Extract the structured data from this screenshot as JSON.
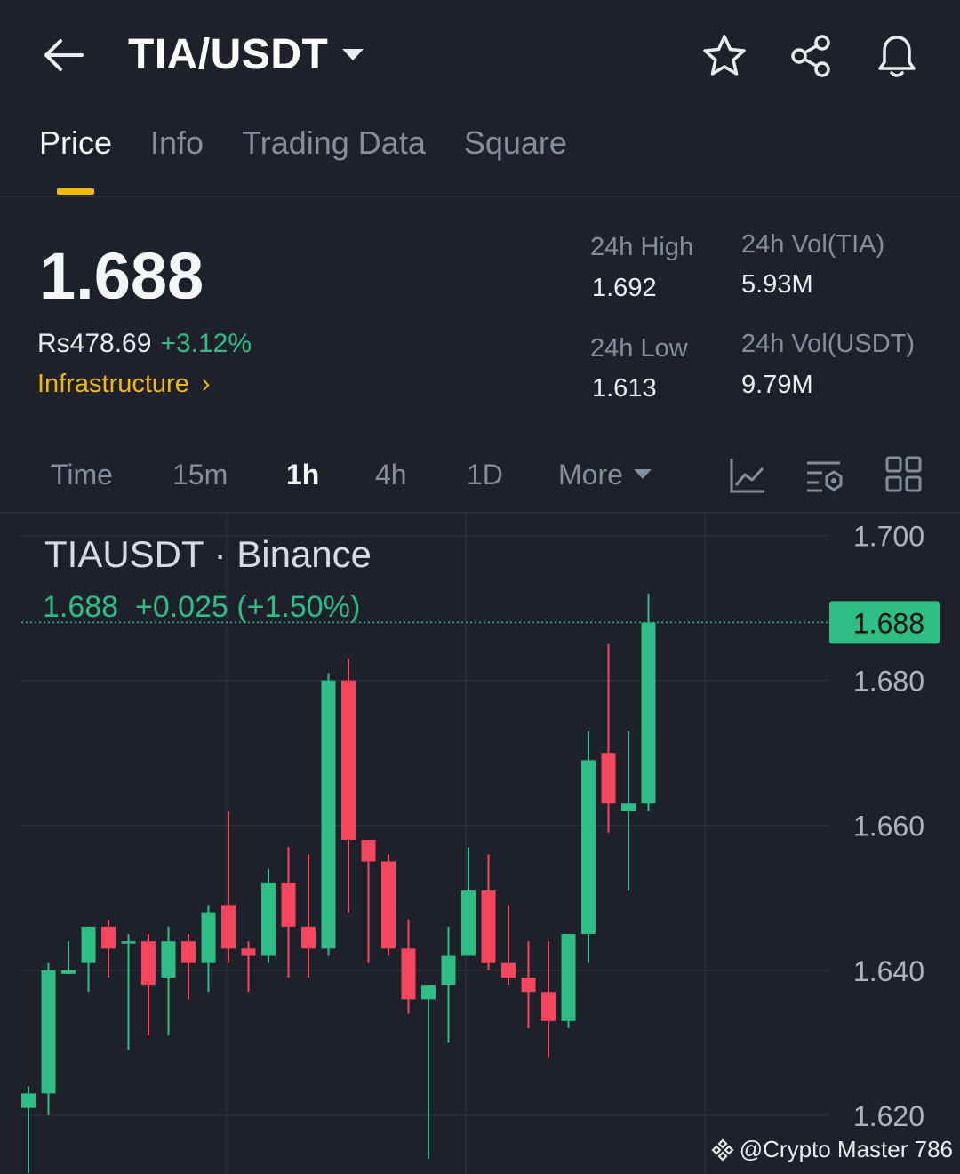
{
  "header": {
    "pair": "TIA/USDT"
  },
  "tabs": [
    "Price",
    "Info",
    "Trading Data",
    "Square"
  ],
  "price": {
    "last": "1.688",
    "fiat": "Rs478.69",
    "change": "+3.12%",
    "tag": "Infrastructure",
    "high_label": "24h High",
    "high": "1.692",
    "low_label": "24h Low",
    "low": "1.613",
    "vol_base_label": "24h Vol(TIA)",
    "vol_base": "5.93M",
    "vol_quote_label": "24h Vol(USDT)",
    "vol_quote": "9.79M"
  },
  "timeframes": [
    "Time",
    "15m",
    "1h",
    "4h",
    "1D",
    "More"
  ],
  "active_timeframe": "1h",
  "chart_header": {
    "title": "TIAUSDT · Binance",
    "summary": "1.688  +0.025 (+1.50%)"
  },
  "watermark": "@Crypto Master 786",
  "colors": {
    "up": "#2ebd85",
    "down": "#f6465d",
    "accent": "#f0b90b",
    "bg": "#1e2129"
  },
  "chart_data": {
    "type": "candlestick",
    "y_ticks": [
      "1.700",
      "1.680",
      "1.660",
      "1.640",
      "1.620"
    ],
    "ylim": [
      1.6125,
      1.7013
    ],
    "current_price_label": "1.688",
    "current_price": 1.688,
    "candles": [
      {
        "o": 1.621,
        "h": 1.624,
        "l": 1.612,
        "c": 1.623
      },
      {
        "o": 1.623,
        "h": 1.641,
        "l": 1.62,
        "c": 1.64
      },
      {
        "o": 1.6395,
        "h": 1.644,
        "l": 1.6395,
        "c": 1.64
      },
      {
        "o": 1.641,
        "h": 1.646,
        "l": 1.637,
        "c": 1.646
      },
      {
        "o": 1.646,
        "h": 1.647,
        "l": 1.639,
        "c": 1.643
      },
      {
        "o": 1.644,
        "h": 1.645,
        "l": 1.629,
        "c": 1.644
      },
      {
        "o": 1.644,
        "h": 1.645,
        "l": 1.631,
        "c": 1.638
      },
      {
        "o": 1.639,
        "h": 1.646,
        "l": 1.631,
        "c": 1.644
      },
      {
        "o": 1.644,
        "h": 1.645,
        "l": 1.636,
        "c": 1.641
      },
      {
        "o": 1.641,
        "h": 1.649,
        "l": 1.637,
        "c": 1.648
      },
      {
        "o": 1.649,
        "h": 1.662,
        "l": 1.641,
        "c": 1.643
      },
      {
        "o": 1.643,
        "h": 1.644,
        "l": 1.637,
        "c": 1.642
      },
      {
        "o": 1.642,
        "h": 1.654,
        "l": 1.641,
        "c": 1.652
      },
      {
        "o": 1.652,
        "h": 1.657,
        "l": 1.639,
        "c": 1.646
      },
      {
        "o": 1.646,
        "h": 1.656,
        "l": 1.639,
        "c": 1.643
      },
      {
        "o": 1.643,
        "h": 1.681,
        "l": 1.642,
        "c": 1.68
      },
      {
        "o": 1.68,
        "h": 1.683,
        "l": 1.648,
        "c": 1.658
      },
      {
        "o": 1.658,
        "h": 1.658,
        "l": 1.641,
        "c": 1.655
      },
      {
        "o": 1.655,
        "h": 1.656,
        "l": 1.642,
        "c": 1.643
      },
      {
        "o": 1.643,
        "h": 1.647,
        "l": 1.634,
        "c": 1.636
      },
      {
        "o": 1.636,
        "h": 1.637,
        "l": 1.614,
        "c": 1.638
      },
      {
        "o": 1.638,
        "h": 1.646,
        "l": 1.63,
        "c": 1.642
      },
      {
        "o": 1.642,
        "h": 1.657,
        "l": 1.642,
        "c": 1.651
      },
      {
        "o": 1.651,
        "h": 1.656,
        "l": 1.64,
        "c": 1.641
      },
      {
        "o": 1.641,
        "h": 1.649,
        "l": 1.638,
        "c": 1.639
      },
      {
        "o": 1.639,
        "h": 1.644,
        "l": 1.632,
        "c": 1.637
      },
      {
        "o": 1.637,
        "h": 1.644,
        "l": 1.628,
        "c": 1.633
      },
      {
        "o": 1.633,
        "h": 1.645,
        "l": 1.632,
        "c": 1.645
      },
      {
        "o": 1.645,
        "h": 1.673,
        "l": 1.641,
        "c": 1.669
      },
      {
        "o": 1.67,
        "h": 1.685,
        "l": 1.659,
        "c": 1.663
      },
      {
        "o": 1.662,
        "h": 1.673,
        "l": 1.651,
        "c": 1.663
      },
      {
        "o": 1.663,
        "h": 1.692,
        "l": 1.662,
        "c": 1.688
      }
    ]
  }
}
